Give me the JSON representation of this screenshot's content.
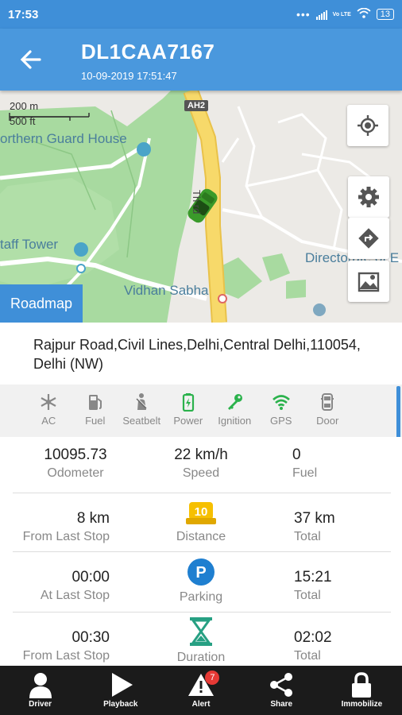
{
  "status_bar": {
    "time": "17:53",
    "network": "Vo LTE",
    "battery": "13"
  },
  "header": {
    "title": "DL1CAA7167",
    "timestamp": "10-09-2019 17:51:47",
    "back_icon": "arrow-left-icon"
  },
  "map": {
    "scale_metric": "200 m",
    "scale_imperial": "500 ft",
    "highway_badge": "AH2",
    "labels": {
      "northern_guard_house": "orthern Guard House",
      "staff_tower": "taff Tower",
      "vidhan_sabha": "Vidhan Sabha",
      "directorate": "Directorate of E",
      "road": "Th     rd"
    },
    "roadmap_button": "Roadmap",
    "buttons": [
      "locate-icon",
      "settings-icon",
      "directions-icon",
      "map-layers-icon"
    ],
    "colors": {
      "park": "#a8daa0",
      "road": "#f7d96a",
      "car": "#3a9a2a"
    }
  },
  "address": "Rajpur Road,Civil Lines,Delhi,Central Delhi,110054, Delhi (NW)",
  "vehicle_status": [
    {
      "label": "AC",
      "icon": "snowflake-icon",
      "active": false
    },
    {
      "label": "Fuel",
      "icon": "fuel-pump-icon",
      "active": false
    },
    {
      "label": "Seatbelt",
      "icon": "seatbelt-icon",
      "active": false
    },
    {
      "label": "Power",
      "icon": "battery-icon",
      "active": true
    },
    {
      "label": "Ignition",
      "icon": "key-icon",
      "active": true
    },
    {
      "label": "GPS",
      "icon": "wifi-icon",
      "active": true
    },
    {
      "label": "Door",
      "icon": "door-icon",
      "active": false
    }
  ],
  "stats": {
    "odometer": {
      "value": "10095.73",
      "label": "Odometer"
    },
    "speed": {
      "value": "22 km/h",
      "label": "Speed"
    },
    "fuel": {
      "value": "0",
      "label": "Fuel"
    },
    "from_last_stop": {
      "value": "8 km",
      "label": "From Last Stop"
    },
    "distance": {
      "label": "Distance",
      "badge": "10"
    },
    "total_distance": {
      "value": "37 km",
      "label": "Total"
    },
    "at_last_stop": {
      "value": "00:00",
      "label": "At Last Stop"
    },
    "parking": {
      "label": "Parking",
      "badge": "P"
    },
    "total_parking": {
      "value": "15:21",
      "label": "Total"
    },
    "from_last_stop_duration": {
      "value": "00:30",
      "label": "From Last Stop"
    },
    "duration": {
      "label": "Duration"
    },
    "total_duration": {
      "value": "02:02",
      "label": "Total"
    }
  },
  "bottom_nav": [
    {
      "label": "Driver",
      "icon": "person-icon"
    },
    {
      "label": "Playback",
      "icon": "play-icon"
    },
    {
      "label": "Alert",
      "icon": "alert-icon",
      "badge": "7"
    },
    {
      "label": "Share",
      "icon": "share-icon"
    },
    {
      "label": "Immobilize",
      "icon": "lock-icon"
    }
  ],
  "accent_color": "#3f8fd8"
}
